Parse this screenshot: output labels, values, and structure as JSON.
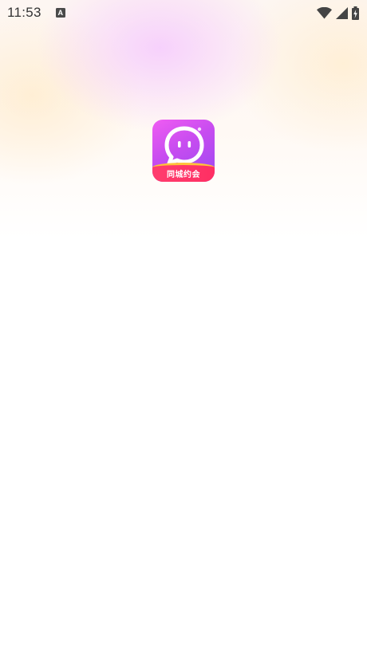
{
  "status_bar": {
    "time": "11:53",
    "notification_icon": "a-icon",
    "notification_letter": "A",
    "icons": [
      "wifi-icon",
      "cell-signal-icon",
      "battery-icon"
    ]
  },
  "app": {
    "icon_label": "同城约会",
    "colors": {
      "gradient_start": "#f05cf2",
      "gradient_end": "#9a49f2",
      "band": "#ff3d6e",
      "band_accent": "#ffc33a"
    }
  }
}
